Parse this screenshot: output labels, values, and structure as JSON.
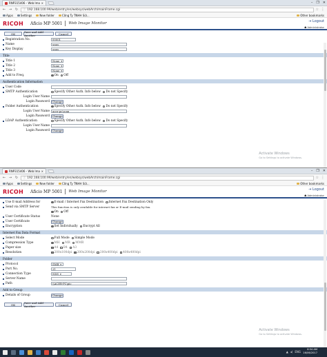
{
  "browser": {
    "tab_title": "RNP315406 - Web Imag",
    "window_controls": [
      "–",
      "❐",
      "✕"
    ],
    "url": "192.168.100.99/web/entry/en/websys/webArch/mainFrame.cgi",
    "bookmarks": [
      "Apps",
      "Settings",
      "New folder",
      "Công Ty TNHH Sửi..."
    ],
    "other_bookmarks": "Other bookmarks"
  },
  "header": {
    "logo": "RICOH",
    "model": "Aficio MP 5001",
    "subtitle": "Web Image Monitor",
    "logout": "Logout",
    "user": "Administrator"
  },
  "buttons": {
    "ok": "OK",
    "save_add": "Save and Add Another",
    "cancel": "Cancel",
    "change": "Change"
  },
  "screen1": {
    "registration_no": {
      "label": "Registration No.",
      "value": "00001"
    },
    "name": {
      "label": "Name",
      "value": "scan"
    },
    "key_display": {
      "label": "Key Display",
      "value": "scan"
    },
    "title_section": "Title",
    "title1": {
      "label": "Title 1",
      "value": "None"
    },
    "title2": {
      "label": "Title 2",
      "value": "None"
    },
    "title3": {
      "label": "Title 3",
      "value": "None"
    },
    "add_to_freq": {
      "label": "Add to Freq.",
      "on": "On",
      "off": "Off"
    },
    "auth_section": "Authentication Information",
    "user_code": {
      "label": "User Code"
    },
    "smtp_auth": {
      "label": "SMTP Authentication",
      "opt1": "Specify Other Auth. Info below",
      "opt2": "Do not Specify"
    },
    "login_user_name": "Login User Name",
    "login_password": "Login Password",
    "folder_auth": {
      "label": "Folder Authentication",
      "opt1": "Specify Other Auth. Info below",
      "opt2": "Do not Specify",
      "user_value": "acer-pc\\scan"
    },
    "ldap_auth": {
      "label": "LDAP Authentication",
      "opt1": "Specify Other Auth. Info below",
      "opt2": "Do not Specify"
    }
  },
  "screen2": {
    "use_email": {
      "label": "Use E-mail Address for",
      "opt1": "E-mail / Internet Fax Destination",
      "opt2": "Internet Fax Destination Only"
    },
    "send_via_smtp": {
      "label": "Send via SMTP Server",
      "note": "This function is only available for internet fax or E-mail sending by fax."
    },
    "on": "On",
    "off": "Off",
    "use_cert_status": {
      "label": "User Certificate Status",
      "value": "None"
    },
    "user_cert": {
      "label": "User Certificate"
    },
    "encryption": {
      "label": "Encryption",
      "opt1": "Set Individually",
      "opt2": "Encrypt All"
    },
    "ifax_section": "Internet Fax Data Format",
    "select_mode": {
      "label": "Select Mode",
      "opt1": "Full Mode",
      "opt2": "Simple Mode"
    },
    "compression": {
      "label": "Compression Type",
      "opts": [
        "MH",
        "MR",
        "MMR"
      ]
    },
    "paper_size": {
      "label": "Paper size",
      "opts": [
        "A4",
        "B4",
        "A3"
      ]
    },
    "resolution": {
      "label": "Resolution",
      "opts": [
        "200x100dpi",
        "200x200dpi",
        "200x400dpi",
        "400x400dpi"
      ]
    },
    "folder_section": "Folder",
    "protocol": {
      "label": "Protocol",
      "value": "SMB"
    },
    "port_no": {
      "label": "Port No.",
      "value": "21"
    },
    "connection_type": {
      "label": "Connection Type",
      "value": "NDS"
    },
    "server_name": {
      "label": "Server Name"
    },
    "path": {
      "label": "Path",
      "value": "\\\\ACER-PC\\pic"
    },
    "group_section": "Add to Group",
    "details_of_group": {
      "label": "Details of Group"
    }
  },
  "watermark": {
    "title": "Activate Windows",
    "sub": "Go to Settings to activate Windows."
  },
  "taskbar": {
    "time": "8:54 AM",
    "date": "16/06/2017",
    "lang": "ENG"
  }
}
